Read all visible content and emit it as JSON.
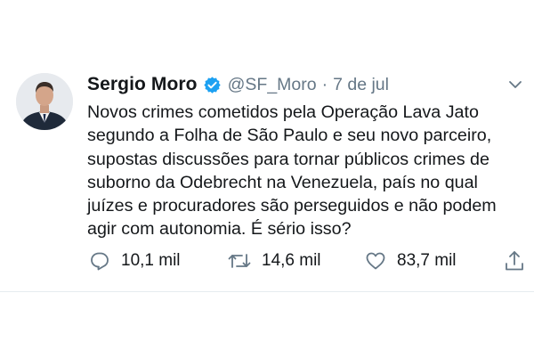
{
  "tweet": {
    "author": {
      "name": "Sergio Moro",
      "handle": "@SF_Moro",
      "separator": "·",
      "date": "7 de jul"
    },
    "text_lines": [
      "Novos crimes cometidos pela Operação Lava Jato",
      "segundo a Folha de São Paulo e seu novo parceiro,",
      "supostas discussões para tornar públicos crimes de",
      "suborno da Odebrecht na Venezuela, país no qual",
      "juízes e procuradores são perseguidos e não podem",
      "agir com autonomia. É sério isso?"
    ],
    "actions": {
      "replies": "10,1 mil",
      "retweets": "14,6 mil",
      "likes": "83,7 mil"
    }
  },
  "colors": {
    "verified": "#1da1f2",
    "muted": "#657786",
    "text": "#14171a"
  },
  "icons": {
    "verified": "verified-badge-icon",
    "menu": "chevron-down-icon",
    "reply": "reply-icon",
    "retweet": "retweet-icon",
    "like": "heart-icon",
    "share": "share-icon"
  }
}
